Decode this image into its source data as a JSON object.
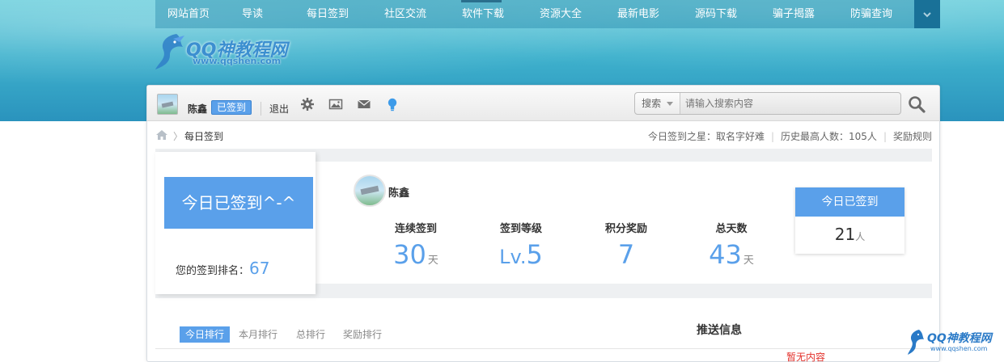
{
  "nav": {
    "items": [
      "网站首页",
      "导读",
      "每日签到",
      "社区交流",
      "软件下载",
      "资源大全",
      "最新电影",
      "源码下载",
      "骗子揭露",
      "防骗查询"
    ],
    "active": "每日签到"
  },
  "logo": {
    "title": "QQ神教程网",
    "url": "www.qqshen.com"
  },
  "toolbar": {
    "username": "陈鑫",
    "badge": "已签到",
    "logout": "退出",
    "search_type": "搜索",
    "search_placeholder": "请输入搜索内容"
  },
  "breadcrumb": {
    "current": "每日签到",
    "star_label": "今日签到之星：取名字好难",
    "history_label": "历史最高人数：105人",
    "rules_label": "奖励规则"
  },
  "sign": {
    "button": "今日已签到^-^",
    "rank_label": "您的签到排名：",
    "rank_value": "67"
  },
  "stats": {
    "username": "陈鑫",
    "items": [
      {
        "label": "连续签到",
        "prefix": "",
        "value": "30",
        "unit": "天"
      },
      {
        "label": "签到等级",
        "prefix": "Lv.",
        "value": "5",
        "unit": ""
      },
      {
        "label": "积分奖励",
        "prefix": "",
        "value": "7",
        "unit": ""
      },
      {
        "label": "总天数",
        "prefix": "",
        "value": "43",
        "unit": "天"
      }
    ]
  },
  "today": {
    "title": "今日已签到",
    "count": "21",
    "unit": "人"
  },
  "ranking_tabs": [
    "今日排行",
    "本月排行",
    "总排行",
    "奖励排行"
  ],
  "push": {
    "title": "推送信息",
    "empty": "暂无内容"
  },
  "corner_logo": {
    "title": "QQ神教程网",
    "url": "www.qqshen.com"
  },
  "colors": {
    "accent": "#5aa0ea",
    "nav_bg": "#3fb2cd",
    "empty_red": "#e3312b"
  }
}
